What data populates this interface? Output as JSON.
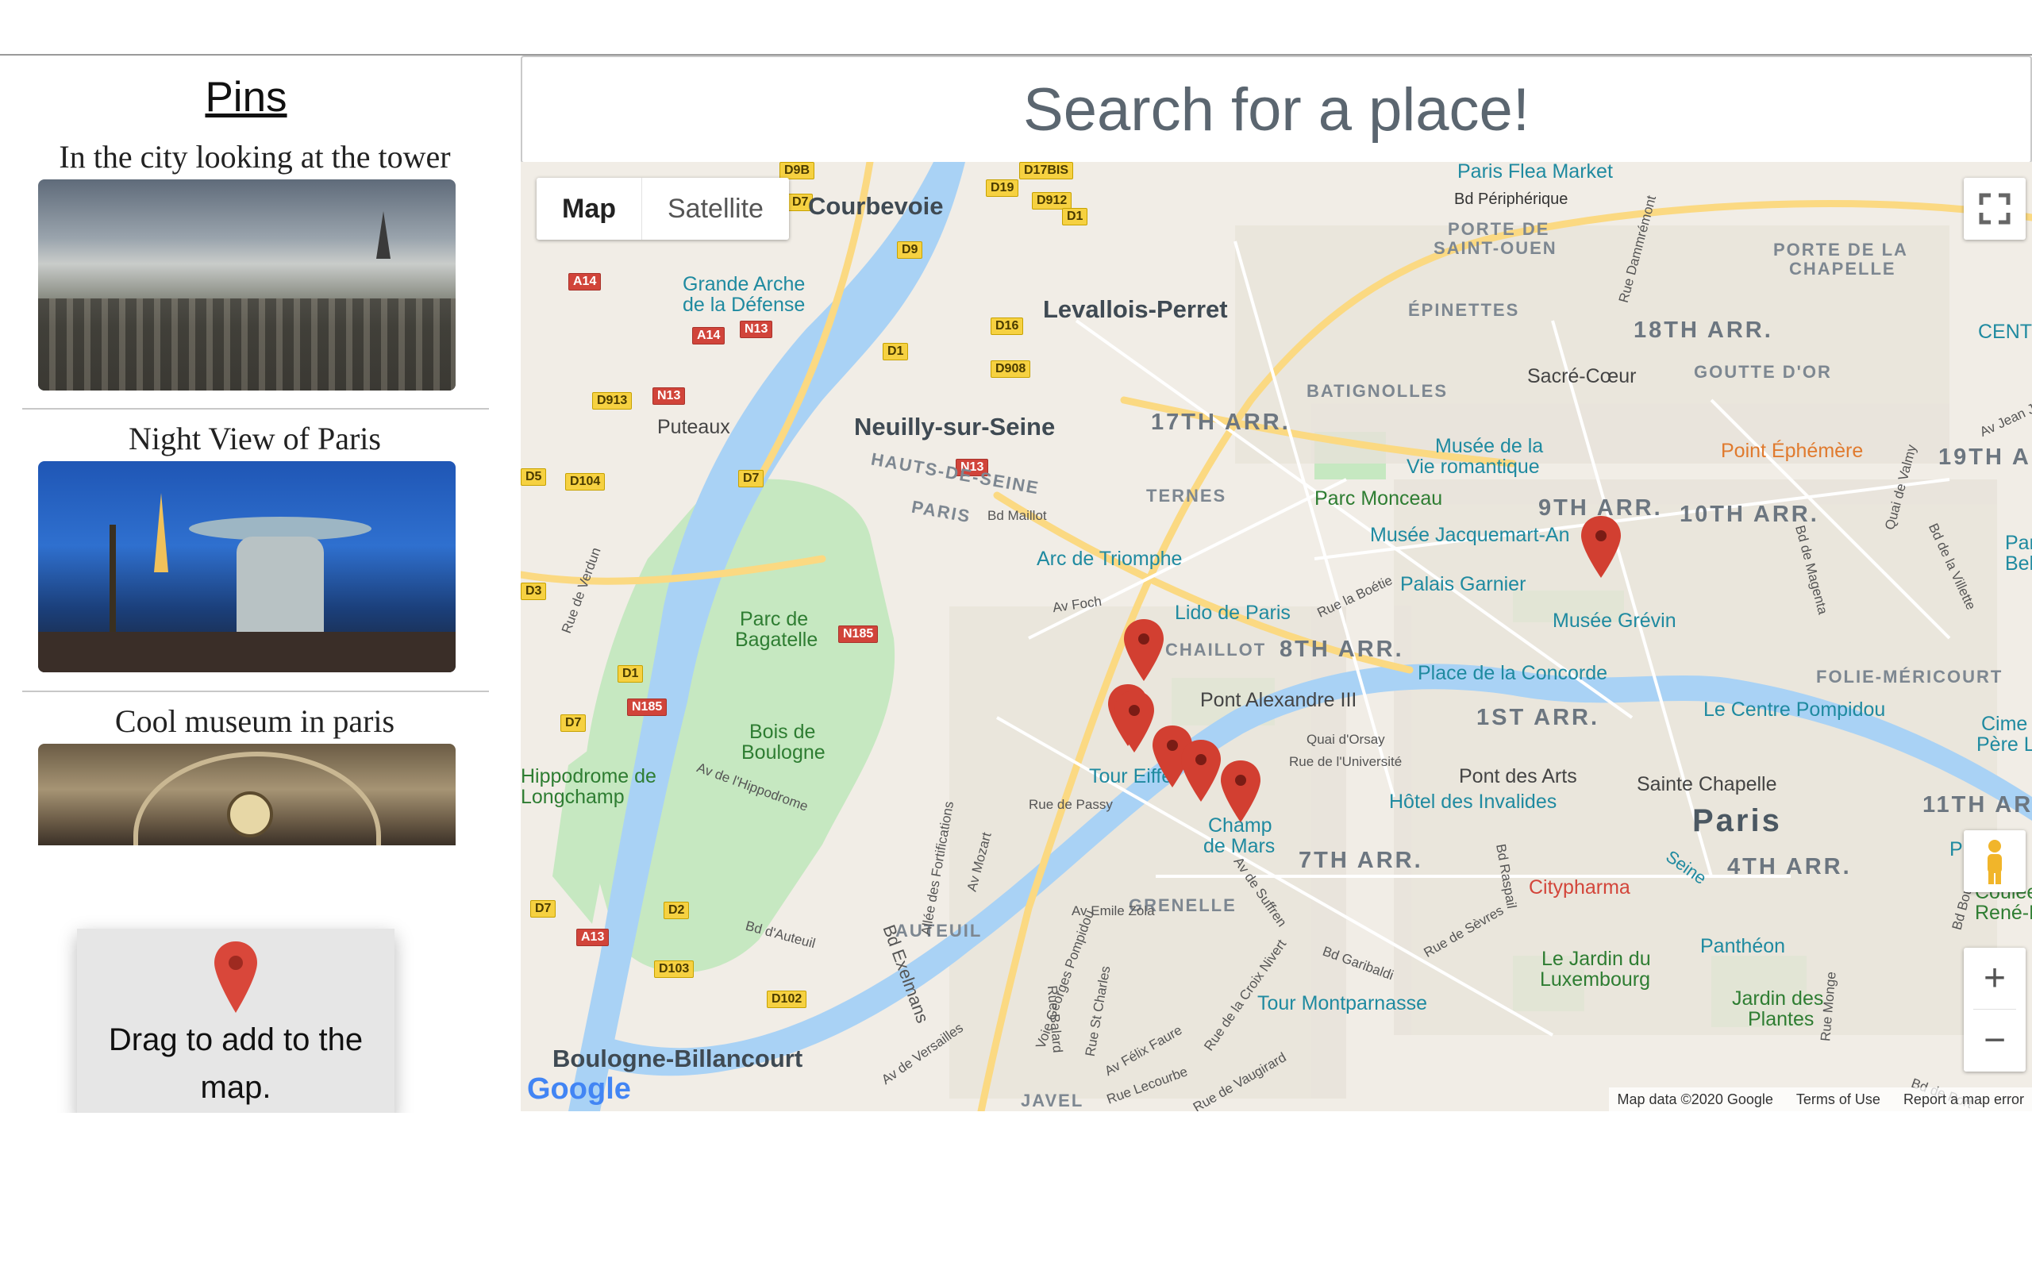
{
  "sidebar": {
    "title": "Pins",
    "pins": [
      {
        "caption": "In the city looking at the tower"
      },
      {
        "caption": "Night View of Paris"
      },
      {
        "caption": "Cool museum in paris"
      }
    ],
    "drag_hint": "Drag to add to the map."
  },
  "search": {
    "placeholder": "Search for a place!"
  },
  "map_controls": {
    "map_label": "Map",
    "satellite_label": "Satellite",
    "zoom_in": "+",
    "zoom_out": "−"
  },
  "attribution": {
    "data": "Map data ©2020 Google",
    "terms": "Terms of Use",
    "report": "Report a map error",
    "logo": "Google"
  },
  "map_labels": {
    "towns": [
      "Courbevoie",
      "Levallois-Perret",
      "Neuilly-sur-Seine",
      "Puteaux",
      "Boulogne-Billancourt",
      "Paris"
    ],
    "arrondissements": [
      "17TH ARR.",
      "18TH ARR.",
      "19TH A",
      "9TH ARR.",
      "10TH ARR.",
      "8TH ARR.",
      "1ST ARR.",
      "7TH ARR.",
      "4TH ARR.",
      "11TH AR"
    ],
    "neighborhoods": [
      "PORTE DE",
      "SAINT-OUEN",
      "PORTE DE LA",
      "CHAPELLE",
      "ÉPINETTES",
      "BATIGNOLLES",
      "GOUTTE D'OR",
      "TERNES",
      "HAUTS-DE-SEINE",
      "PARIS",
      "FOLIE-MÉRICOURT",
      "GRENELLE",
      "AUTEUIL",
      "JAVEL",
      "CHAILLOT"
    ],
    "pois": [
      "Paris Flea Market",
      "Grande Arche",
      "de la Défense",
      "Sacré-Cœur",
      "CENTQUA",
      "Musée de la",
      "Vie romantique",
      "Point Éphémère",
      "Parc Monceau",
      "Musée Jacquemart-An",
      "Arc de Triomphe",
      "Palais Garnier",
      "Musée Grévin",
      "Lido de Paris",
      "Place de la Concorde",
      "Pont Alexandre III",
      "Le Centre Pompidou",
      "Cime",
      "Père La",
      "Tour Eiffel",
      "Champ",
      "de Mars",
      "Pont des Arts",
      "Sainte Chapelle",
      "Hôtel des Invalides",
      "Plac",
      "Citypharma",
      "Panthéon",
      "Le Jardin du",
      "Luxembourg",
      "Jardin des",
      "Plantes",
      "Tour Montparnasse",
      "Coulée ve",
      "René-Dum",
      "Par",
      "Bell",
      "Parc de",
      "Bagatelle",
      "Bois de",
      "Boulogne",
      "Hippodrome de",
      "Longchamp"
    ],
    "streets": [
      "Bd Périphérique",
      "Bd Maillot",
      "Av Foch",
      "Rue la Boétie",
      "Quai d'Orsay",
      "Rue de l'Université",
      "Rue de Passy",
      "Av Emile Zola",
      "Rue Dammrémont",
      "Bd Exelmans",
      "Bd d'Auteuil",
      "Av de Versailles",
      "Rue de Sèvres",
      "Bd Raspail",
      "Bd Garibaldi",
      "Av de Suffren",
      "Rue de Vaugirard",
      "Rue Lecourbe",
      "Av Félix Faure",
      "Rue de la Croix Nivert",
      "Rue St Charles",
      "Rue Balard",
      "Voie Georges Pompidou",
      "Av Mozart",
      "Allée des Fortifications",
      "Av de l'Hippodrome",
      "Rue de Verdun",
      "Bd de Magenta",
      "Quai de Valmy",
      "Bd de la Villette",
      "Av Jean J",
      "Bd Bourdon",
      "Rue Monge",
      "Bd de Port",
      "Seine"
    ],
    "shields": [
      "D9B",
      "D17BIS",
      "D19",
      "D912",
      "D7",
      "D1",
      "A14",
      "D9",
      "A14",
      "N13",
      "D16",
      "D1",
      "D908",
      "D913",
      "N13",
      "D104",
      "D7",
      "N13",
      "N185",
      "D1",
      "N185",
      "D7",
      "D2",
      "A13",
      "D103",
      "D102",
      "D7",
      "D3",
      "D5"
    ]
  },
  "pins_on_map": 6,
  "colors": {
    "accent_marker": "#d23f31",
    "search_text": "#5b6670",
    "water": "#a9d2f5",
    "park": "#c6e8c1",
    "road_major": "#fbd982"
  }
}
